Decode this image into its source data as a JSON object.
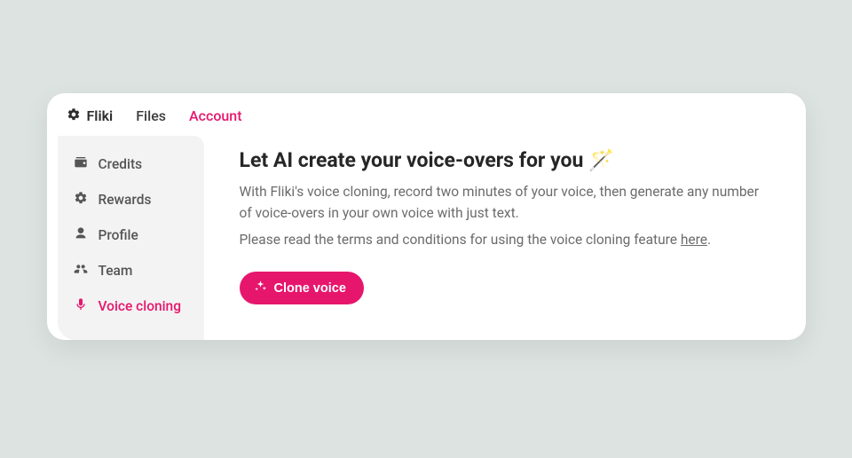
{
  "brand": {
    "name": "Fliki"
  },
  "topnav": {
    "items": [
      {
        "label": "Files",
        "active": false
      },
      {
        "label": "Account",
        "active": true
      }
    ]
  },
  "sidebar": {
    "items": [
      {
        "label": "Credits",
        "icon": "wallet-icon",
        "active": false
      },
      {
        "label": "Rewards",
        "icon": "gear-icon",
        "active": false
      },
      {
        "label": "Profile",
        "icon": "user-icon",
        "active": false
      },
      {
        "label": "Team",
        "icon": "group-icon",
        "active": false
      },
      {
        "label": "Voice cloning",
        "icon": "mic-icon",
        "active": true
      }
    ]
  },
  "main": {
    "title": "Let AI create your voice-overs for you 🪄",
    "description": "With Fliki's voice cloning, record two minutes of your voice, then generate any number of voice-overs in your own voice with just text.",
    "terms_prefix": "Please read the terms and conditions for using the voice cloning feature ",
    "terms_link": "here",
    "terms_suffix": ".",
    "button_label": "Clone voice"
  },
  "colors": {
    "accent": "#e6166d",
    "bg": "#dce3e0",
    "card": "#ffffff",
    "sidebar": "#f3f3f3",
    "text": "#262626",
    "muted": "#6b6b6b"
  }
}
